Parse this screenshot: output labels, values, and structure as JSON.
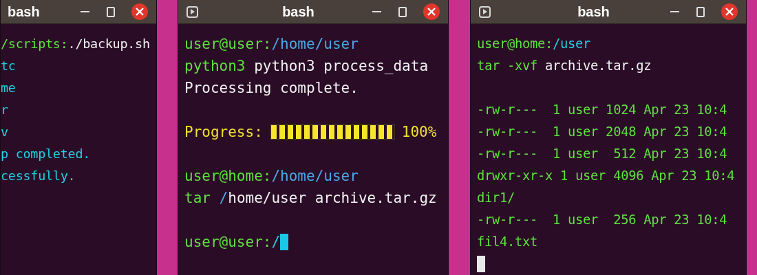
{
  "windows": [
    {
      "title": "bash",
      "app_icon": false,
      "lines": [
        {
          "kind": "text",
          "segments": [
            {
              "kind": "prompt",
              "text": "/scripts:"
            },
            {
              "kind": "command",
              "text": "./backup.sh"
            }
          ]
        },
        {
          "kind": "text",
          "segments": [
            {
              "kind": "output",
              "text": "tc"
            }
          ]
        },
        {
          "kind": "text",
          "segments": [
            {
              "kind": "output",
              "text": "me"
            }
          ]
        },
        {
          "kind": "text",
          "segments": [
            {
              "kind": "output",
              "text": "r"
            }
          ]
        },
        {
          "kind": "text",
          "segments": [
            {
              "kind": "output",
              "text": "v"
            }
          ]
        },
        {
          "kind": "text",
          "segments": [
            {
              "kind": "output",
              "text": "p completed."
            }
          ]
        },
        {
          "kind": "text",
          "segments": [
            {
              "kind": "output",
              "text": "cessfully."
            }
          ]
        }
      ]
    },
    {
      "title": "bash",
      "app_icon": true,
      "lines": [
        {
          "kind": "text",
          "segments": [
            {
              "kind": "prompt",
              "text": "user@user:"
            },
            {
              "kind": "path",
              "text": "/home/user"
            }
          ]
        },
        {
          "kind": "text",
          "segments": [
            {
              "kind": "prompt",
              "text": "python3"
            },
            {
              "kind": "command",
              "text": " python3 process_data"
            }
          ]
        },
        {
          "kind": "text",
          "segments": [
            {
              "kind": "command",
              "text": "Processing complete."
            }
          ]
        },
        {
          "kind": "blank"
        },
        {
          "kind": "progress",
          "label": "Progress:",
          "level": 1,
          "reading": "100%"
        },
        {
          "kind": "blank"
        },
        {
          "kind": "text",
          "segments": [
            {
              "kind": "prompt",
              "text": "user@home:"
            },
            {
              "kind": "path",
              "text": "/home/user"
            }
          ]
        },
        {
          "kind": "text",
          "segments": [
            {
              "kind": "prompt",
              "text": "tar"
            },
            {
              "kind": "path",
              "text": " /"
            },
            {
              "kind": "command",
              "text": "home/user archive.tar.gz"
            }
          ]
        },
        {
          "kind": "blank"
        },
        {
          "kind": "text",
          "segments": [
            {
              "kind": "prompt",
              "text": "user@user:"
            },
            {
              "kind": "output",
              "text": "/"
            }
          ],
          "cursor": {
            "color": "#19c8e6"
          }
        }
      ]
    },
    {
      "title": "bash",
      "app_icon": true,
      "lines": [
        {
          "kind": "text",
          "segments": [
            {
              "kind": "prompt",
              "text": "user@home:"
            },
            {
              "kind": "output",
              "text": "/user"
            }
          ]
        },
        {
          "kind": "text",
          "segments": [
            {
              "kind": "prompt",
              "text": "tar -xvf"
            },
            {
              "kind": "command",
              "text": " archive.tar.gz"
            }
          ]
        },
        {
          "kind": "blank"
        },
        {
          "kind": "text",
          "segments": [
            {
              "kind": "prompt",
              "text": "-rw-r---  1 user 1024 Apr 23 10:4"
            }
          ]
        },
        {
          "kind": "text",
          "segments": [
            {
              "kind": "prompt",
              "text": "-rw-r---  1 user 2048 Apr 23 10:4"
            }
          ]
        },
        {
          "kind": "text",
          "segments": [
            {
              "kind": "prompt",
              "text": "-rw-r---  1 user  512 Apr 23 10:4"
            }
          ]
        },
        {
          "kind": "text",
          "segments": [
            {
              "kind": "prompt",
              "text": "drwxr-xr-x 1 user 4096 Apr 23 10:4"
            }
          ]
        },
        {
          "kind": "text",
          "segments": [
            {
              "kind": "prompt",
              "text": "dir1/"
            }
          ]
        },
        {
          "kind": "text",
          "segments": [
            {
              "kind": "prompt",
              "text": "-rw-r---  1 user  256 Apr 23 10:4"
            }
          ]
        },
        {
          "kind": "text",
          "segments": [
            {
              "kind": "prompt",
              "text": "fil4.txt"
            }
          ]
        },
        {
          "kind": "text",
          "cursor": {
            "color": "#e8e8e8"
          }
        }
      ]
    }
  ]
}
